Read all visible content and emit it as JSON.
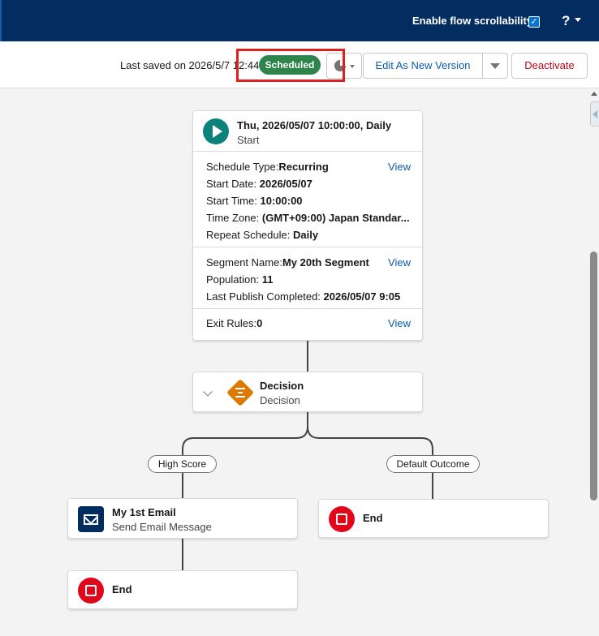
{
  "header": {
    "scroll_label": "Enable flow scrollability",
    "help_label": "?"
  },
  "toolbar": {
    "last_saved": "Last saved on 2026/5/7 12:44",
    "status": "Scheduled",
    "edit_label": "Edit As New Version",
    "deactivate_label": "Deactivate"
  },
  "start_node": {
    "title": "Thu, 2026/05/07 10:00:00, Daily",
    "subtitle": "Start",
    "schedule": {
      "type_label": "Schedule Type:",
      "type_value": "Recurring",
      "start_date_label": "Start Date:",
      "start_date_value": "2026/05/07",
      "start_time_label": "Start Time:",
      "start_time_value": "10:00:00",
      "time_zone_label": "Time Zone:",
      "time_zone_value": "(GMT+09:00) Japan Standar...",
      "repeat_label": "Repeat Schedule:",
      "repeat_value": "Daily",
      "view": "View"
    },
    "segment": {
      "name_label": "Segment Name:",
      "name_value": "My 20th Segment",
      "population_label": "Population:",
      "population_value": "11",
      "last_publish_label": "Last Publish Completed:",
      "last_publish_value": "2026/05/07 9:05",
      "view": "View"
    },
    "exit": {
      "label": "Exit Rules:",
      "value": "0",
      "view": "View"
    }
  },
  "decision_node": {
    "title": "Decision",
    "subtitle": "Decision"
  },
  "branches": {
    "left": "High Score",
    "right": "Default Outcome"
  },
  "email_node": {
    "title": "My 1st Email",
    "subtitle": "Send Email Message"
  },
  "end_nodes": {
    "left": "End",
    "right": "End"
  },
  "colors": {
    "header_bg": "#032d60",
    "status_green": "#2e844a",
    "start_teal": "#0b827c",
    "decision_orange": "#dd7a01",
    "end_red": "#e3061b",
    "highlight_red": "#e02020"
  }
}
